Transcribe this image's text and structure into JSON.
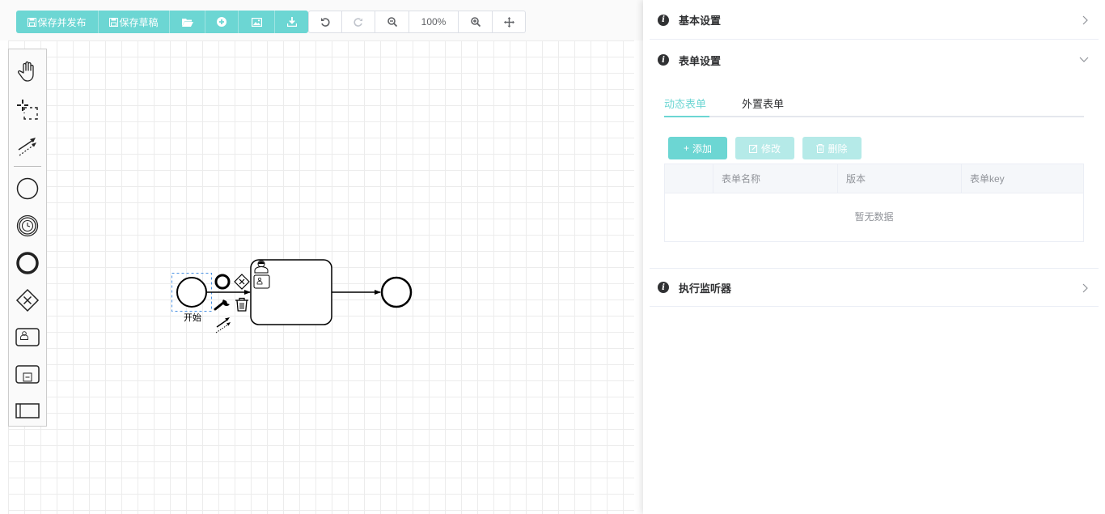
{
  "toolbar": {
    "save_publish_label": "保存并发布",
    "save_draft_label": "保存草稿",
    "zoom_level": "100%"
  },
  "diagram": {
    "start_event_label": "开始"
  },
  "panel": {
    "sections": {
      "basic": {
        "title": "基本设置",
        "expanded": false
      },
      "form": {
        "title": "表单设置",
        "expanded": true
      },
      "listener": {
        "title": "执行监听器",
        "expanded": false
      }
    },
    "tabs": [
      {
        "label": "动态表单",
        "active": true
      },
      {
        "label": "外置表单",
        "active": false
      }
    ],
    "buttons": {
      "add_label": "添加",
      "edit_label": "修改",
      "delete_label": "删除"
    },
    "table": {
      "columns": [
        "表单名称",
        "版本",
        "表单key"
      ],
      "empty_text": "暂无数据"
    }
  },
  "colors": {
    "accent": "#6cd6d3",
    "accent_disabled": "#b5eae8"
  }
}
